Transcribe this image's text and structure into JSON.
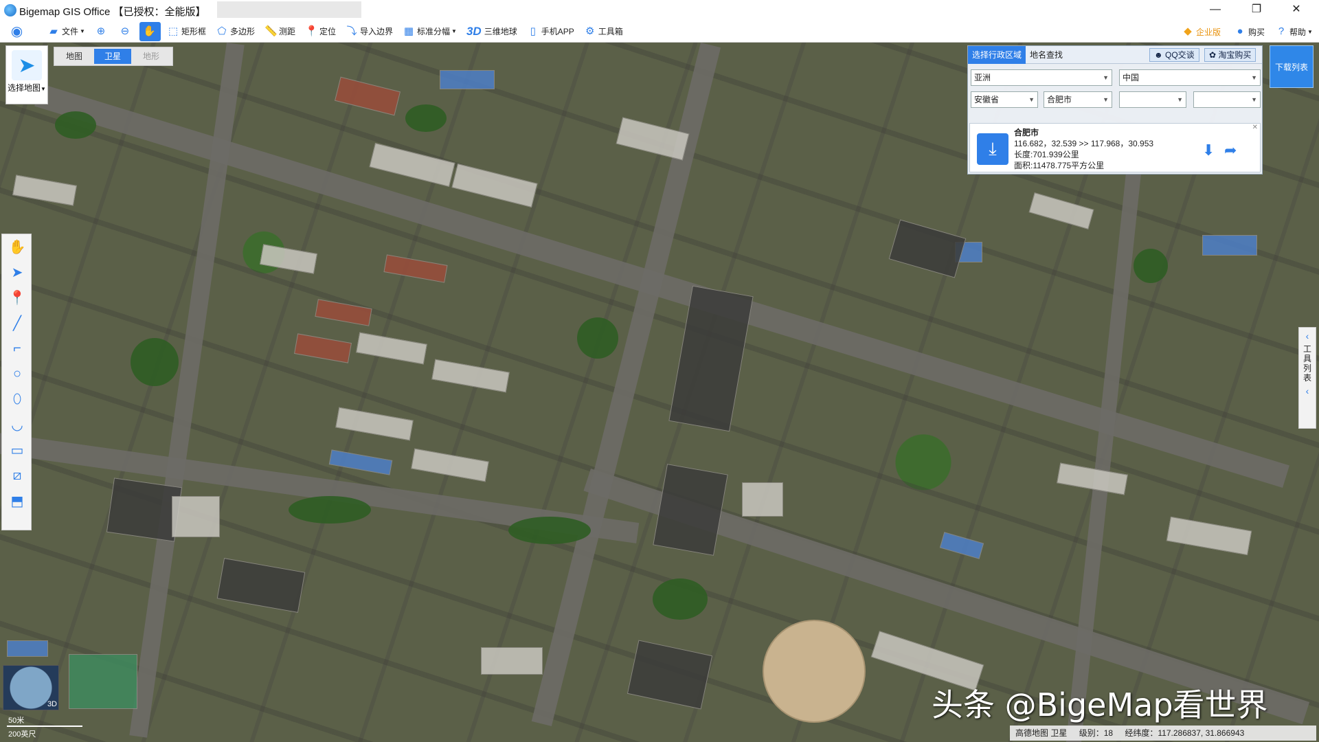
{
  "window": {
    "title": "Bigemap GIS Office 【已授权：全能版】",
    "minimize": "—",
    "restore": "❐",
    "close": "✕"
  },
  "toolbar": {
    "items": [
      {
        "label": "文件",
        "icon": "folder-icon",
        "dropdown": true
      },
      {
        "label": "",
        "icon": "zoom-in-icon"
      },
      {
        "label": "",
        "icon": "zoom-out-icon"
      },
      {
        "label": "",
        "icon": "pan-hand-icon",
        "active": true
      },
      {
        "label": "矩形框",
        "icon": "rectangle-select-icon"
      },
      {
        "label": "多边形",
        "icon": "polygon-select-icon"
      },
      {
        "label": "测距",
        "icon": "measure-icon"
      },
      {
        "label": "定位",
        "icon": "locate-icon"
      },
      {
        "label": "导入边界",
        "icon": "import-boundary-icon"
      },
      {
        "label": "标准分幅",
        "icon": "grid-icon",
        "dropdown": true
      },
      {
        "label": "三维地球",
        "icon": "3d-globe-icon"
      },
      {
        "label": "手机APP",
        "icon": "phone-icon"
      },
      {
        "label": "工具箱",
        "icon": "gear-icon"
      }
    ],
    "enterprise": "企业版",
    "buy": "购买",
    "help": "帮助",
    "threeD": "3D"
  },
  "map_panel": {
    "select_map": "选择地图",
    "tabs": [
      {
        "label": "地图",
        "active": false
      },
      {
        "label": "卫星",
        "active": true
      },
      {
        "label": "地形",
        "active": false
      }
    ]
  },
  "region_panel": {
    "tab_select_region": "选择行政区域",
    "tab_place_search": "地名查找",
    "qq_button": "QQ交谈",
    "taobao_button": "淘宝购买",
    "continent": "亚洲",
    "country": "中国",
    "province": "安徽省",
    "city": "合肥市",
    "district": "",
    "town": "",
    "result": {
      "name": "合肥市",
      "bounds": "116.682，32.539 >> 117.968，30.953",
      "length": "长度:701.939公里",
      "area": "面积:11478.775平方公里"
    }
  },
  "download_list": "下载列表",
  "tool_list": "工具列表",
  "globe_label": "3D",
  "scale": {
    "metric": "50米",
    "imperial": "200英尺"
  },
  "watermark": "头条 @BigeMap看世界",
  "status": {
    "source": "高德地图 卫星",
    "level": "级别：18",
    "coords": "经纬度：117.286837, 31.866943"
  }
}
